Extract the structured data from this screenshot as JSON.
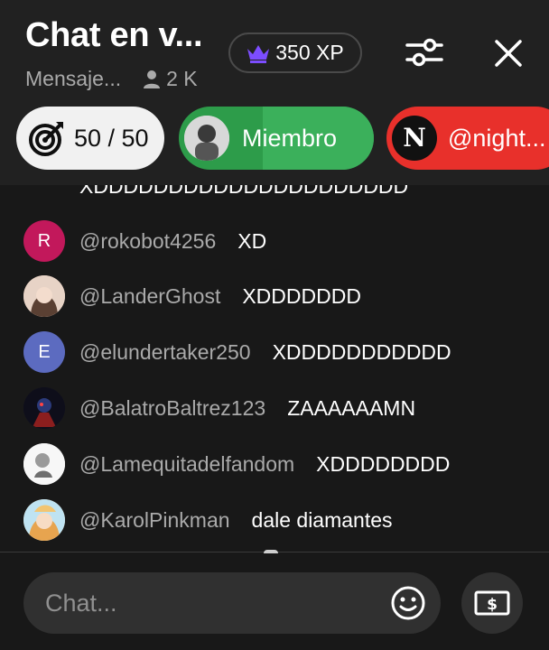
{
  "header": {
    "title": "Chat en v...",
    "subtitle": "Mensaje...",
    "viewer_count": "2 K",
    "xp_label": "350 XP"
  },
  "pills": {
    "goal": "50 / 50",
    "member": "Miembro",
    "user": "@night..."
  },
  "chat": {
    "cut_message": "XDDDDDDDDDDDDDDDDDDDDD",
    "messages": [
      {
        "initial": "R",
        "author": "@rokobot4256",
        "text": "XD",
        "avatar_color": "#c2185b"
      },
      {
        "initial": "",
        "author": "@LanderGhost",
        "text": "XDDDDDDD",
        "avatar_color": "#d9b9a6"
      },
      {
        "initial": "E",
        "author": "@elundertaker250",
        "text": "XDDDDDDDDDDD",
        "avatar_color": "#5c6bc0"
      },
      {
        "initial": "",
        "author": "@BalatroBaltrez123",
        "text": "ZAAAAAAMN",
        "avatar_color": "#1a1a2e"
      },
      {
        "initial": "",
        "author": "@Lamequitadelfandom",
        "text": "XDDDDDDDD",
        "avatar_color": "#f5f5f5"
      },
      {
        "initial": "",
        "author": "@KarolPinkman",
        "text": "dale diamantes",
        "avatar_color": "#e8b06a"
      }
    ]
  },
  "input": {
    "placeholder": "Chat..."
  },
  "colors": {
    "background": "#181818",
    "header_bg": "#212121",
    "member_green": "#2d9c4a",
    "user_red": "#e8302b",
    "xp_purple": "#7c4dff"
  },
  "icons": {
    "crown": "crown-icon",
    "filter": "sliders-icon",
    "close": "close-icon",
    "goal": "target-icon",
    "viewers": "person-icon",
    "emoji": "emoji-icon",
    "money": "money-icon"
  }
}
